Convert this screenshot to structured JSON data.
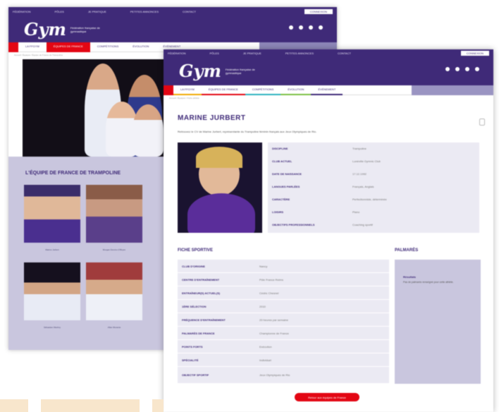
{
  "colors": {
    "brand": "#3f2a78",
    "accent": "#e30613",
    "soft": "#c9c6de"
  },
  "back": {
    "topbar": [
      "Fédération",
      "Pôles",
      "Je pratique",
      "Petites annonces",
      "Contact"
    ],
    "connect": "Connexion",
    "logo_mark": "Gym",
    "logo_text": "Fédération française de gymnastique",
    "nav": [
      "La FFGym",
      "Équipes de France",
      "Compétitions",
      "Évolution",
      "Événement"
    ],
    "crumb": "Accueil / Équipes / Équipe de France de Trampoline",
    "team_title": "L'équipe de France de Trampoline",
    "athletes": [
      "Marine Jurbert",
      "Morgan Demiro-O'Bryen",
      "Sébastien Martiny",
      "Allan Morante"
    ]
  },
  "front": {
    "topbar": [
      "Fédération",
      "Pôles",
      "Je pratique",
      "Petites annonces",
      "Contact"
    ],
    "connect": "Connexion",
    "logo_mark": "Gym",
    "logo_text": "Fédération française de gymnastique",
    "nav": [
      "La FFGym",
      "Équipes de France",
      "Compétitions",
      "Évolution",
      "Événement"
    ],
    "crumb": "Accueil / Équipes / Fiche athlète",
    "athlete_name": "MARINE JURBERT",
    "intro": "Retrouvez le CV de Marine Jurbert, représentante du Trampoline féminin français aux Jeux Olympiques de Rio.",
    "info": [
      {
        "k": "Discipline",
        "v": "Trampoline"
      },
      {
        "k": "Club actuel",
        "v": "Lunéville Gymnic Club"
      },
      {
        "k": "Date de naissance",
        "v": "17.12.1992"
      },
      {
        "k": "Langues parlées",
        "v": "Français, Anglais"
      },
      {
        "k": "Caractère",
        "v": "Perfectionniste, déterminée"
      },
      {
        "k": "Loisirs",
        "v": "Piano"
      },
      {
        "k": "Objectifs professionnels",
        "v": "Coaching sportif"
      }
    ],
    "sport_title": "Fiche sportive",
    "sport": [
      {
        "k": "Club d'origine",
        "v": "Nancy"
      },
      {
        "k": "Centre d'entraînement",
        "v": "Pôle France Reims"
      },
      {
        "k": "Entraîneur(s) actuel(s)",
        "v": "Cédric Chesnel"
      },
      {
        "k": "1ère sélection",
        "v": "2010"
      },
      {
        "k": "Fréquence d'entraînement",
        "v": "20 heures par semaine"
      },
      {
        "k": "Palmarès de France",
        "v": "Championne de France"
      },
      {
        "k": "Points forts",
        "v": "Exécution"
      },
      {
        "k": "Spécialité",
        "v": "Individuel"
      },
      {
        "k": "Objectif sportif",
        "v": "Jeux Olympiques de Rio"
      }
    ],
    "palmares_title": "Palmarès",
    "palmares_item": "Résultats",
    "palmares_text": "Pas de palmarès renseigné pour cette athlète.",
    "cta": "Retour aux équipes de France"
  }
}
